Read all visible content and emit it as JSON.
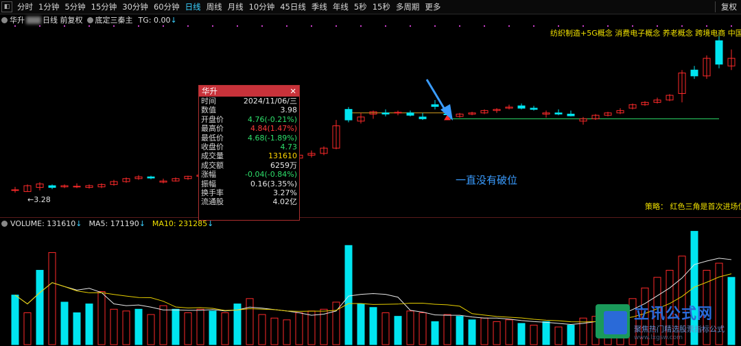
{
  "toolbar": {
    "periods": [
      "分时",
      "1分钟",
      "5分钟",
      "15分钟",
      "30分钟",
      "60分钟",
      "日线",
      "周线",
      "月线",
      "10分钟",
      "45日线",
      "季线",
      "年线",
      "5秒",
      "15秒",
      "多周期",
      "更多"
    ],
    "active_period": "日线",
    "fuquan": "复权"
  },
  "infobar": {
    "stock_name": "华升",
    "chart_mode": "日线 前复权",
    "indicator": "底定三秦主",
    "tg": "TG: 0.00"
  },
  "concepts": "纺织制造+5G概念 消费电子概念 养老概念 跨境电商 中国",
  "strategy": "策略：  红色三角是首次进场位",
  "annotation": "一直没有破位",
  "low_label": "←3.28",
  "volume_header": {
    "volume": "VOLUME: 131610",
    "ma5": "MA5: 171190",
    "ma10": "MA10: 231285"
  },
  "popup": {
    "title": "华升",
    "rows": [
      {
        "k": "时间",
        "v": "2024/11/06/三",
        "c": "white"
      },
      {
        "k": "数值",
        "v": "3.98",
        "c": "white"
      },
      {
        "k": "开盘价",
        "v": "4.76(-0.21%)",
        "c": "green"
      },
      {
        "k": "最高价",
        "v": "4.84(1.47%)",
        "c": "red"
      },
      {
        "k": "最低价",
        "v": "4.68(-1.89%)",
        "c": "green"
      },
      {
        "k": "收盘价",
        "v": "4.73",
        "c": "green"
      },
      {
        "k": "成交量",
        "v": "131610",
        "c": "yellow"
      },
      {
        "k": "成交额",
        "v": "6259万",
        "c": "white"
      },
      {
        "k": "涨幅",
        "v": "-0.04(-0.84%)",
        "c": "green"
      },
      {
        "k": "振幅",
        "v": "0.16(3.35%)",
        "c": "white"
      },
      {
        "k": "换手率",
        "v": "3.27%",
        "c": "white"
      },
      {
        "k": "流通股",
        "v": "4.02亿",
        "c": "white"
      }
    ]
  },
  "watermark": {
    "big": "立讯公式网",
    "small": "聚焦热门精选股票指标公式",
    "url": "www.lxgsw.com"
  },
  "colors": {
    "up": "#ff2a2a",
    "down": "#00e5f0",
    "ma10": "#e8d000",
    "ma5": "#e8e8e8",
    "support": "#2ee06b",
    "arrow": "#3a9cff"
  },
  "chart_data": {
    "type": "candlestick+volume",
    "price_candles": [
      {
        "o": 3.3,
        "h": 3.36,
        "l": 3.26,
        "c": 3.31
      },
      {
        "o": 3.28,
        "h": 3.4,
        "l": 3.28,
        "c": 3.38
      },
      {
        "o": 3.35,
        "h": 3.44,
        "l": 3.3,
        "c": 3.41
      },
      {
        "o": 3.38,
        "h": 3.4,
        "l": 3.32,
        "c": 3.35
      },
      {
        "o": 3.36,
        "h": 3.4,
        "l": 3.34,
        "c": 3.38
      },
      {
        "o": 3.36,
        "h": 3.42,
        "l": 3.34,
        "c": 3.37
      },
      {
        "o": 3.35,
        "h": 3.4,
        "l": 3.33,
        "c": 3.38
      },
      {
        "o": 3.36,
        "h": 3.42,
        "l": 3.34,
        "c": 3.4
      },
      {
        "o": 3.4,
        "h": 3.48,
        "l": 3.38,
        "c": 3.45
      },
      {
        "o": 3.45,
        "h": 3.52,
        "l": 3.43,
        "c": 3.5
      },
      {
        "o": 3.5,
        "h": 3.56,
        "l": 3.48,
        "c": 3.53
      },
      {
        "o": 3.53,
        "h": 3.55,
        "l": 3.49,
        "c": 3.51
      },
      {
        "o": 3.44,
        "h": 3.5,
        "l": 3.42,
        "c": 3.46
      },
      {
        "o": 3.46,
        "h": 3.52,
        "l": 3.45,
        "c": 3.5
      },
      {
        "o": 3.5,
        "h": 3.55,
        "l": 3.48,
        "c": 3.54
      },
      {
        "o": 3.54,
        "h": 3.58,
        "l": 3.52,
        "c": 3.56
      },
      {
        "o": 3.56,
        "h": 3.58,
        "l": 3.52,
        "c": 3.55
      },
      {
        "o": 3.58,
        "h": 3.7,
        "l": 3.56,
        "c": 3.68
      },
      {
        "o": 3.68,
        "h": 3.74,
        "l": 3.66,
        "c": 3.71
      },
      {
        "o": 3.71,
        "h": 3.78,
        "l": 3.69,
        "c": 3.75
      },
      {
        "o": 3.75,
        "h": 3.82,
        "l": 3.73,
        "c": 3.8
      },
      {
        "o": 3.8,
        "h": 3.84,
        "l": 3.76,
        "c": 3.79
      },
      {
        "o": 3.8,
        "h": 3.88,
        "l": 3.78,
        "c": 3.85
      },
      {
        "o": 3.85,
        "h": 3.94,
        "l": 3.82,
        "c": 3.9
      },
      {
        "o": 3.9,
        "h": 3.98,
        "l": 3.86,
        "c": 3.93
      },
      {
        "o": 3.93,
        "h": 4.05,
        "l": 3.9,
        "c": 4.02
      },
      {
        "o": 4.02,
        "h": 4.5,
        "l": 4.0,
        "c": 4.4
      },
      {
        "o": 4.68,
        "h": 4.72,
        "l": 4.46,
        "c": 4.5
      },
      {
        "o": 4.48,
        "h": 4.62,
        "l": 4.44,
        "c": 4.55
      },
      {
        "o": 4.6,
        "h": 4.66,
        "l": 4.52,
        "c": 4.64
      },
      {
        "o": 4.62,
        "h": 4.68,
        "l": 4.56,
        "c": 4.6
      },
      {
        "o": 4.62,
        "h": 4.66,
        "l": 4.58,
        "c": 4.63
      },
      {
        "o": 4.62,
        "h": 4.66,
        "l": 4.56,
        "c": 4.58
      },
      {
        "o": 4.55,
        "h": 4.62,
        "l": 4.5,
        "c": 4.52
      },
      {
        "o": 4.76,
        "h": 4.84,
        "l": 4.68,
        "c": 4.73
      },
      {
        "o": 4.6,
        "h": 4.64,
        "l": 4.56,
        "c": 4.59
      },
      {
        "o": 4.56,
        "h": 4.62,
        "l": 4.54,
        "c": 4.6
      },
      {
        "o": 4.6,
        "h": 4.64,
        "l": 4.58,
        "c": 4.62
      },
      {
        "o": 4.62,
        "h": 4.68,
        "l": 4.6,
        "c": 4.66
      },
      {
        "o": 4.66,
        "h": 4.7,
        "l": 4.62,
        "c": 4.68
      },
      {
        "o": 4.7,
        "h": 4.76,
        "l": 4.68,
        "c": 4.72
      },
      {
        "o": 4.74,
        "h": 4.78,
        "l": 4.68,
        "c": 4.7
      },
      {
        "o": 4.7,
        "h": 4.74,
        "l": 4.66,
        "c": 4.68
      },
      {
        "o": 4.6,
        "h": 4.66,
        "l": 4.54,
        "c": 4.62
      },
      {
        "o": 4.62,
        "h": 4.68,
        "l": 4.58,
        "c": 4.6
      },
      {
        "o": 4.6,
        "h": 4.66,
        "l": 4.56,
        "c": 4.57
      },
      {
        "o": 4.48,
        "h": 4.55,
        "l": 4.42,
        "c": 4.52
      },
      {
        "o": 4.52,
        "h": 4.6,
        "l": 4.5,
        "c": 4.58
      },
      {
        "o": 4.58,
        "h": 4.64,
        "l": 4.56,
        "c": 4.62
      },
      {
        "o": 4.62,
        "h": 4.7,
        "l": 4.6,
        "c": 4.66
      },
      {
        "o": 4.7,
        "h": 4.78,
        "l": 4.68,
        "c": 4.76
      },
      {
        "o": 4.76,
        "h": 4.82,
        "l": 4.74,
        "c": 4.8
      },
      {
        "o": 4.8,
        "h": 4.88,
        "l": 4.78,
        "c": 4.84
      },
      {
        "o": 4.84,
        "h": 4.94,
        "l": 4.82,
        "c": 4.92
      },
      {
        "o": 4.95,
        "h": 5.35,
        "l": 4.8,
        "c": 5.3
      },
      {
        "o": 5.35,
        "h": 5.42,
        "l": 5.2,
        "c": 5.25
      },
      {
        "o": 5.25,
        "h": 5.6,
        "l": 5.2,
        "c": 5.55
      },
      {
        "o": 5.85,
        "h": 6.0,
        "l": 5.38,
        "c": 5.45
      },
      {
        "o": 5.42,
        "h": 5.7,
        "l": 5.35,
        "c": 5.55
      }
    ],
    "volumes": [
      280,
      180,
      420,
      520,
      240,
      180,
      230,
      300,
      200,
      190,
      200,
      170,
      220,
      200,
      180,
      200,
      190,
      180,
      230,
      260,
      170,
      150,
      140,
      180,
      190,
      200,
      240,
      560,
      230,
      210,
      180,
      160,
      190,
      180,
      130,
      170,
      160,
      140,
      150,
      130,
      140,
      120,
      110,
      130,
      100,
      110,
      150,
      160,
      200,
      220,
      260,
      320,
      380,
      420,
      500,
      640,
      420,
      460,
      380
    ],
    "direction": [
      "d",
      "u",
      "d",
      "u",
      "d",
      "d",
      "d",
      "u",
      "u",
      "u",
      "d",
      "u",
      "u",
      "d",
      "u",
      "u",
      "d",
      "u",
      "d",
      "u",
      "u",
      "u",
      "u",
      "u",
      "u",
      "u",
      "u",
      "d",
      "d",
      "d",
      "u",
      "d",
      "u",
      "u",
      "d",
      "u",
      "d",
      "d",
      "u",
      "u",
      "u",
      "d",
      "u",
      "d",
      "u",
      "d",
      "u",
      "u",
      "u",
      "u",
      "u",
      "u",
      "u",
      "u",
      "u",
      "d",
      "u",
      "u",
      "d"
    ],
    "ma5": [
      3.34,
      3.35,
      3.36,
      3.37,
      3.37,
      3.38,
      3.38,
      3.39,
      3.41,
      3.43,
      3.46,
      3.48,
      3.49,
      3.5,
      3.51,
      3.52,
      3.53,
      3.56,
      3.6,
      3.64,
      3.68,
      3.72,
      3.76,
      3.8,
      3.84,
      3.89,
      3.98,
      4.1,
      4.2,
      4.32,
      4.44,
      4.52,
      4.57,
      4.59,
      4.6,
      4.59,
      4.58,
      4.58,
      4.58,
      4.6,
      4.62,
      4.64,
      4.66,
      4.65,
      4.64,
      4.62,
      4.6,
      4.59,
      4.59,
      4.6,
      4.64,
      4.68,
      4.74,
      4.8,
      4.92,
      5.02,
      5.15,
      5.3,
      5.4
    ],
    "support_level": 4.52,
    "marked_high": 3.98,
    "marked_low": 3.28
  }
}
